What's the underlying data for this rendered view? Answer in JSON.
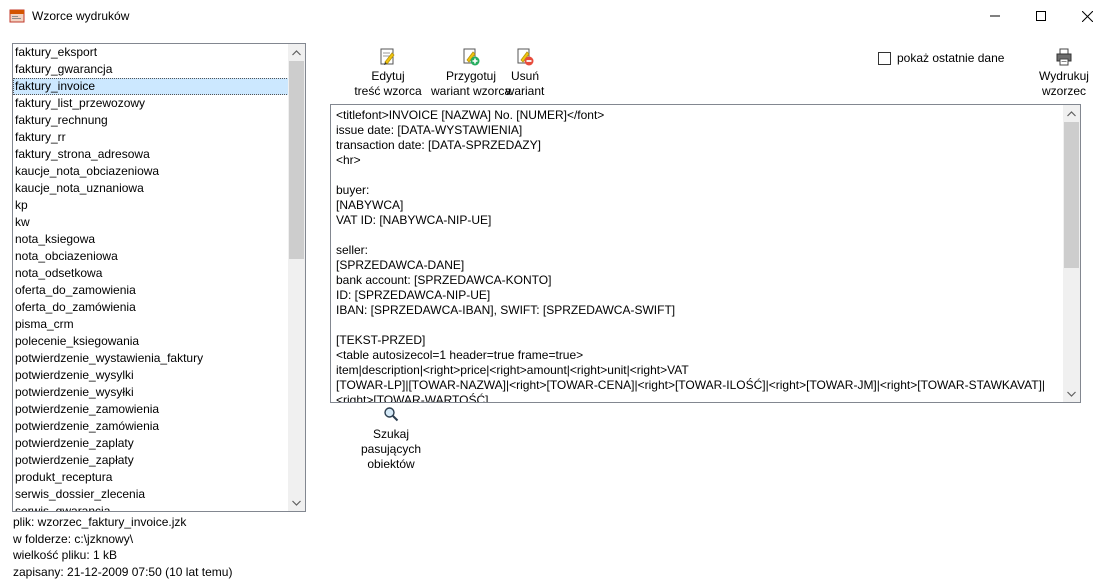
{
  "window": {
    "title": "Wzorce wydruków"
  },
  "list": {
    "items": [
      "faktury_eksport",
      "faktury_gwarancja",
      "faktury_invoice",
      "faktury_list_przewozowy",
      "faktury_rechnung",
      "faktury_rr",
      "faktury_strona_adresowa",
      "kaucje_nota_obciazeniowa",
      "kaucje_nota_uznaniowa",
      "kp",
      "kw",
      "nota_ksiegowa",
      "nota_obciazeniowa",
      "nota_odsetkowa",
      "oferta_do_zamowienia",
      "oferta_do_zamówienia",
      "pisma_crm",
      "polecenie_ksiegowania",
      "potwierdzenie_wystawienia_faktury",
      "potwierdzenie_wysylki",
      "potwierdzenie_wysyłki",
      "potwierdzenie_zamowienia",
      "potwierdzenie_zamówienia",
      "potwierdzenie_zaplaty",
      "potwierdzenie_zapłaty",
      "produkt_receptura",
      "serwis_dossier_zlecenia",
      "serwis_gwarancja"
    ],
    "selected": "faktury_invoice"
  },
  "file_info": {
    "file": "plik: wzorzec_faktury_invoice.jzk",
    "folder": "w folderze: c:\\jzknowy\\",
    "size": "wielkość pliku: 1 kB",
    "saved": "zapisany: 21-12-2009 07:50 (10 lat temu)"
  },
  "toolbar": {
    "edit_line1": "Edytuj",
    "edit_line2": "treść wzorca",
    "prepare_line1": "Przygotuj",
    "prepare_line2": "wariant wzorca",
    "delete_line1": "Usuń",
    "delete_line2": "wariant",
    "show_last_data": "pokaż ostatnie dane",
    "print_line1": "Wydrukuj",
    "print_line2": "wzorzec"
  },
  "editor": {
    "lines": [
      "<titlefont>INVOICE [NAZWA] No. [NUMER]</font>",
      "issue date: [DATA-WYSTAWIENIA]",
      "transaction date: [DATA-SPRZEDAZY]",
      "<hr>",
      "",
      "buyer:",
      "[NABYWCA]",
      "VAT ID: [NABYWCA-NIP-UE]",
      "",
      "seller:",
      "[SPRZEDAWCA-DANE]",
      "bank account: [SPRZEDAWCA-KONTO]",
      "ID: [SPRZEDAWCA-NIP-UE]",
      "IBAN: [SPRZEDAWCA-IBAN], SWIFT: [SPRZEDAWCA-SWIFT]",
      "",
      "[TEKST-PRZED]",
      "<table autosizecol=1 header=true frame=true>",
      "item|description|<right>price|<right>amount|<right>unit|<right>VAT",
      "[TOWAR-LP]|[TOWAR-NAZWA]|<right>[TOWAR-CENA]|<right>[TOWAR-ILOŚĆ]|<right>[TOWAR-JM]|<right>[TOWAR-STAWKAVAT]|",
      "<right>[TOWAR-WARTOŚĆ]"
    ]
  },
  "search": {
    "line1": "Szukaj",
    "line2": "pasujących obiektów"
  },
  "colors": {
    "selection": "#cce8ff",
    "border": "#828790",
    "scrollbar_track": "#f0f0f0",
    "scrollbar_thumb": "#cdcdcd"
  }
}
